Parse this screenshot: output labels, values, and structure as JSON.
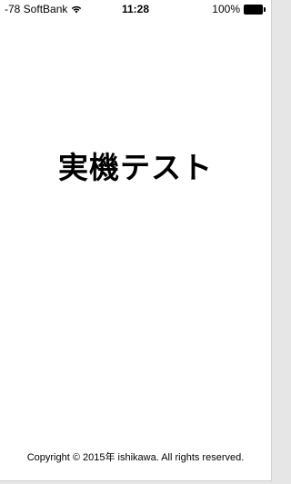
{
  "status_bar": {
    "carrier": "-78 SoftBank",
    "wifi_icon": "wifi-icon",
    "time": "11:28",
    "battery_percent": "100%",
    "battery_icon": "battery-icon",
    "battery_level": 1.0
  },
  "main": {
    "title": "実機テスト"
  },
  "footer": {
    "copyright": "Copyright © 2015年 ishikawa. All rights reserved."
  }
}
